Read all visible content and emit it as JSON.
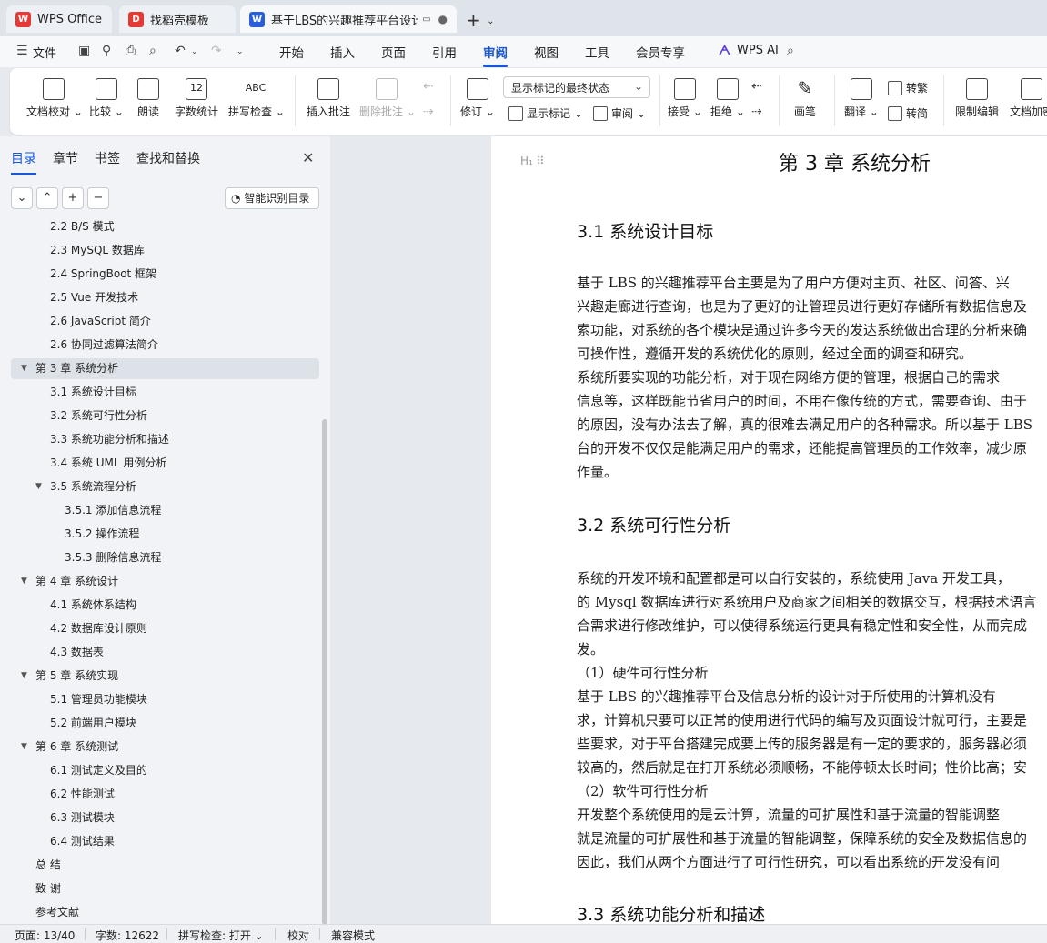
{
  "tabs": [
    {
      "title": "WPS Office",
      "icon": "wps-logo-icon",
      "color": "#e53935"
    },
    {
      "title": "找稻壳模板",
      "icon": "docer-logo-icon",
      "color": "#e53935"
    },
    {
      "title": "基于LBS的兴趣推荐平台设计与",
      "icon": "word-doc-icon",
      "color": "#2b5fd9"
    }
  ],
  "menu": {
    "file": "文件",
    "items": [
      "开始",
      "插入",
      "页面",
      "引用",
      "审阅",
      "视图",
      "工具",
      "会员专享"
    ],
    "active": "审阅",
    "ai": "WPS AI"
  },
  "ribbon": {
    "doc_proof": "文档校对",
    "compare": "比较",
    "read_aloud": "朗读",
    "word_count": "字数统计",
    "spell_check": "拼写检查",
    "abc": "ABC",
    "insert_comment": "插入批注",
    "delete_comment": "删除批注",
    "revise": "修订",
    "show_mode": "显示标记的最终状态",
    "show_marks": "显示标记",
    "review": "审阅",
    "accept": "接受",
    "reject": "拒绝",
    "pen": "画笔",
    "translate": "翻译",
    "to_traditional": "转繁",
    "to_simplified": "转简",
    "restrict_edit": "限制编辑",
    "doc_encrypt": "文档加密"
  },
  "panel": {
    "tabs": [
      "目录",
      "章节",
      "书签",
      "查找和替换"
    ],
    "smart_toc": "智能识别目录",
    "toc": [
      {
        "text": "2.2 B/S 模式",
        "level": 2
      },
      {
        "text": "2.3 MySQL 数据库",
        "level": 2
      },
      {
        "text": "2.4 SpringBoot 框架",
        "level": 2
      },
      {
        "text": "2.5 Vue 开发技术",
        "level": 2
      },
      {
        "text": "2.6 JavaScript 简介",
        "level": 2
      },
      {
        "text": "2.6  协同过滤算法简介",
        "level": 2
      },
      {
        "text": "第 3 章  系统分析",
        "level": 1,
        "expanded": true,
        "selected": true
      },
      {
        "text": "3.1  系统设计目标",
        "level": 2
      },
      {
        "text": "3.2  系统可行性分析",
        "level": 2
      },
      {
        "text": "3.3  系统功能分析和描述",
        "level": 2
      },
      {
        "text": "3.4  系统 UML 用例分析",
        "level": 2
      },
      {
        "text": "3.5 系统流程分析",
        "level": 2,
        "expanded": true
      },
      {
        "text": "3.5.1 添加信息流程",
        "level": 3
      },
      {
        "text": "3.5.2 操作流程",
        "level": 3
      },
      {
        "text": "3.5.3 删除信息流程",
        "level": 3
      },
      {
        "text": "第 4 章  系统设计",
        "level": 1,
        "expanded": true
      },
      {
        "text": "4.1  系统体系结构",
        "level": 2
      },
      {
        "text": "4.2  数据库设计原则",
        "level": 2
      },
      {
        "text": "4.3  数据表",
        "level": 2
      },
      {
        "text": "第 5 章  系统实现",
        "level": 1,
        "expanded": true
      },
      {
        "text": "5.1  管理员功能模块",
        "level": 2
      },
      {
        "text": "5.2  前端用户模块",
        "level": 2
      },
      {
        "text": "第 6 章  系统测试",
        "level": 1,
        "expanded": true
      },
      {
        "text": "6.1 测试定义及目的",
        "level": 2
      },
      {
        "text": "6.2 性能测试",
        "level": 2
      },
      {
        "text": "6.3 测试模块",
        "level": 2
      },
      {
        "text": "6.4 测试结果",
        "level": 2
      },
      {
        "text": "总    结",
        "level": 1
      },
      {
        "text": "致    谢",
        "level": 1
      },
      {
        "text": "参考文献",
        "level": 1
      }
    ]
  },
  "document": {
    "chapter": "第 3 章  系统分析",
    "s31": "3.1  系统设计目标",
    "p1": [
      "        基于 LBS 的兴趣推荐平台主要是为了用户方便对主页、社区、问答、兴",
      "兴趣走廊进行查询，也是为了更好的让管理员进行更好存储所有数据信息及",
      "索功能，对系统的各个模块是通过许多今天的发达系统做出合理的分析来确",
      "可操作性，遵循开发的系统优化的原则，经过全面的调查和研究。",
      "        系统所要实现的功能分析，对于现在网络方便的管理，根据自己的需求",
      "信息等，这样既能节省用户的时间，不用在像传统的方式，需要查询、由于",
      "的原因，没有办法去了解，真的很难去满足用户的各种需求。所以基于 LBS",
      "台的开发不仅仅是能满足用户的需求，还能提高管理员的工作效率，减少原",
      "作量。"
    ],
    "s32": "3.2  系统可行性分析",
    "p2": [
      "        系统的开发环境和配置都是可以自行安装的，系统使用 Java 开发工具，",
      "的 Mysql 数据库进行对系统用户及商家之间相关的数据交互，根据技术语言",
      "合需求进行修改维护，可以使得系统运行更具有稳定性和安全性，从而完成",
      "发。",
      "          （1）硬件可行性分析",
      "        基于 LBS 的兴趣推荐平台及信息分析的设计对于所使用的计算机没有",
      "求，计算机只要可以正常的使用进行代码的编写及页面设计就可行，主要是",
      "些要求，对于平台搭建完成要上传的服务器是有一定的要求的，服务器必须",
      "较高的，然后就是在打开系统必须顺畅，不能停顿太长时间；性价比高；安",
      "          （2）软件可行性分析",
      "        开发整个系统使用的是云计算，流量的可扩展性和基于流量的智能调整",
      "就是流量的可扩展性和基于流量的智能调整，保障系统的安全及数据信息的",
      "        因此，我们从两个方面进行了可行性研究，可以看出系统的开发没有问"
    ],
    "s33": "3.3  系统功能分析和描述"
  },
  "status": {
    "page": "页面: 13/40",
    "words": "字数: 12622",
    "spell": "拼写检查: 打开",
    "proof": "校对",
    "compat": "兼容模式"
  }
}
